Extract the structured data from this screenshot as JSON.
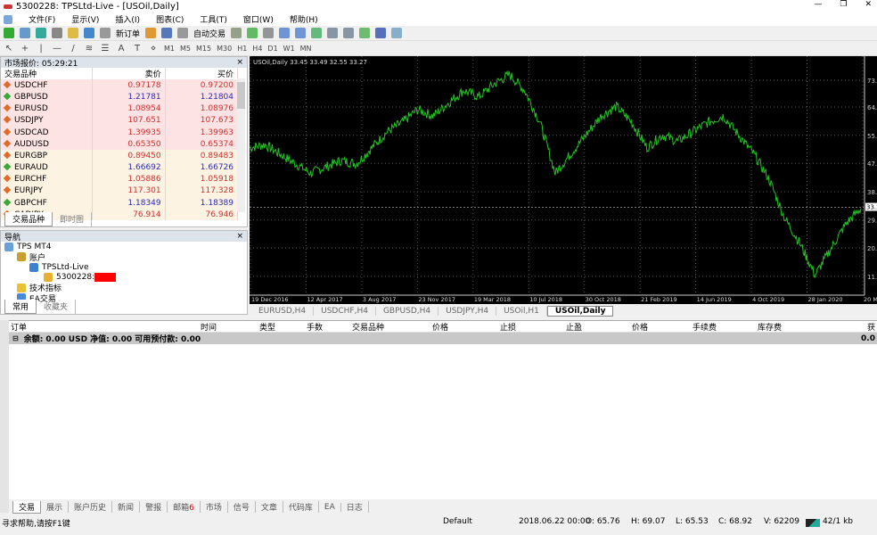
{
  "window": {
    "title": "5300228: TPSLtd-Live - [USOil,Daily]"
  },
  "menu": [
    "文件(F)",
    "显示(V)",
    "插入(I)",
    "图表(C)",
    "工具(T)",
    "窗口(W)",
    "帮助(H)"
  ],
  "toolbar": {
    "new_order": "新订单",
    "auto_trade": "自动交易",
    "timeframes": [
      "M1",
      "M5",
      "M15",
      "M30",
      "H1",
      "H4",
      "D1",
      "W1",
      "MN"
    ]
  },
  "market_watch": {
    "title": "市场报价: 05:29:21",
    "headers": [
      "交易品种",
      "卖价",
      "买价"
    ],
    "rows": [
      {
        "symbol": "USDCHF",
        "bid": "0.97178",
        "ask": "0.97200",
        "dir": "down"
      },
      {
        "symbol": "GBPUSD",
        "bid": "1.21781",
        "ask": "1.21804",
        "dir": "up"
      },
      {
        "symbol": "EURUSD",
        "bid": "1.08954",
        "ask": "1.08976",
        "dir": "down"
      },
      {
        "symbol": "USDJPY",
        "bid": "107.651",
        "ask": "107.673",
        "dir": "down"
      },
      {
        "symbol": "USDCAD",
        "bid": "1.39935",
        "ask": "1.39963",
        "dir": "down"
      },
      {
        "symbol": "AUDUSD",
        "bid": "0.65350",
        "ask": "0.65374",
        "dir": "down"
      },
      {
        "symbol": "EURGBP",
        "bid": "0.89450",
        "ask": "0.89483",
        "dir": "down"
      },
      {
        "symbol": "EURAUD",
        "bid": "1.66692",
        "ask": "1.66726",
        "dir": "up"
      },
      {
        "symbol": "EURCHF",
        "bid": "1.05886",
        "ask": "1.05918",
        "dir": "down"
      },
      {
        "symbol": "EURJPY",
        "bid": "117.301",
        "ask": "117.328",
        "dir": "down"
      },
      {
        "symbol": "GBPCHF",
        "bid": "1.18349",
        "ask": "1.18389",
        "dir": "up"
      },
      {
        "symbol": "CADJPY",
        "bid": "76.914",
        "ask": "76.946",
        "dir": "down"
      }
    ],
    "tabs": [
      "交易品种",
      "即时图"
    ]
  },
  "navigator": {
    "title": "导航",
    "items": [
      "TPS MT4",
      "账户",
      "TPSLtd-Live",
      "5300228:",
      "技术指标",
      "EA交易"
    ],
    "tabs": [
      "常用",
      "收藏夹"
    ]
  },
  "chart": {
    "header": "USOil,Daily  33.45 33.49 32.55 33.27",
    "current_price": "33.27",
    "y_ticks": [
      "73.2",
      "64.8",
      "55.9",
      "47.1",
      "38.2",
      "29.3",
      "20.5",
      "11.6"
    ],
    "x_ticks": [
      "19 Dec 2016",
      "12 Apr 2017",
      "3 Aug 2017",
      "23 Nov 2017",
      "19 Mar 2018",
      "10 Jul 2018",
      "30 Oct 2018",
      "21 Feb 2019",
      "14 Jun 2019",
      "4 Oct 2019",
      "28 Jan 2020",
      "20 May"
    ],
    "line_color": "#22c422",
    "price_path": [
      52,
      53,
      50,
      47,
      44,
      46,
      48,
      47,
      52,
      57,
      60,
      64,
      62,
      66,
      70,
      68,
      72,
      75,
      70,
      60,
      44,
      50,
      56,
      62,
      65,
      60,
      52,
      56,
      54,
      57,
      60,
      62,
      56,
      50,
      42,
      30,
      22,
      12,
      20,
      28,
      33
    ]
  },
  "chart_tabs": [
    "EURUSD,H4",
    "USDCHF,H4",
    "GBPUSD,H4",
    "USDJPY,H4",
    "USOil,H1",
    "USOil,Daily"
  ],
  "terminal": {
    "headers": [
      "订单",
      "时间",
      "类型",
      "手数",
      "交易品种",
      "价格",
      "止损",
      "止盈",
      "价格",
      "手续费",
      "库存费",
      "获"
    ],
    "summary": "余额: 0.00 USD  净值: 0.00  可用预付款: 0.00",
    "summary_value": "0.0",
    "tabs": [
      "交易",
      "展示",
      "账户历史",
      "新闻",
      "警报",
      "邮箱",
      "市场",
      "信号",
      "文章",
      "代码库",
      "EA",
      "日志"
    ],
    "mail_count": "6"
  },
  "status": {
    "help": "寻求帮助,请按F1键",
    "profile": "Default",
    "datetime": "2018.06.22 00:00",
    "open": "O: 65.76",
    "high": "H: 69.07",
    "low": "L: 65.53",
    "close": "C: 68.92",
    "volume": "V: 62209",
    "traffic": "42/1 kb"
  }
}
